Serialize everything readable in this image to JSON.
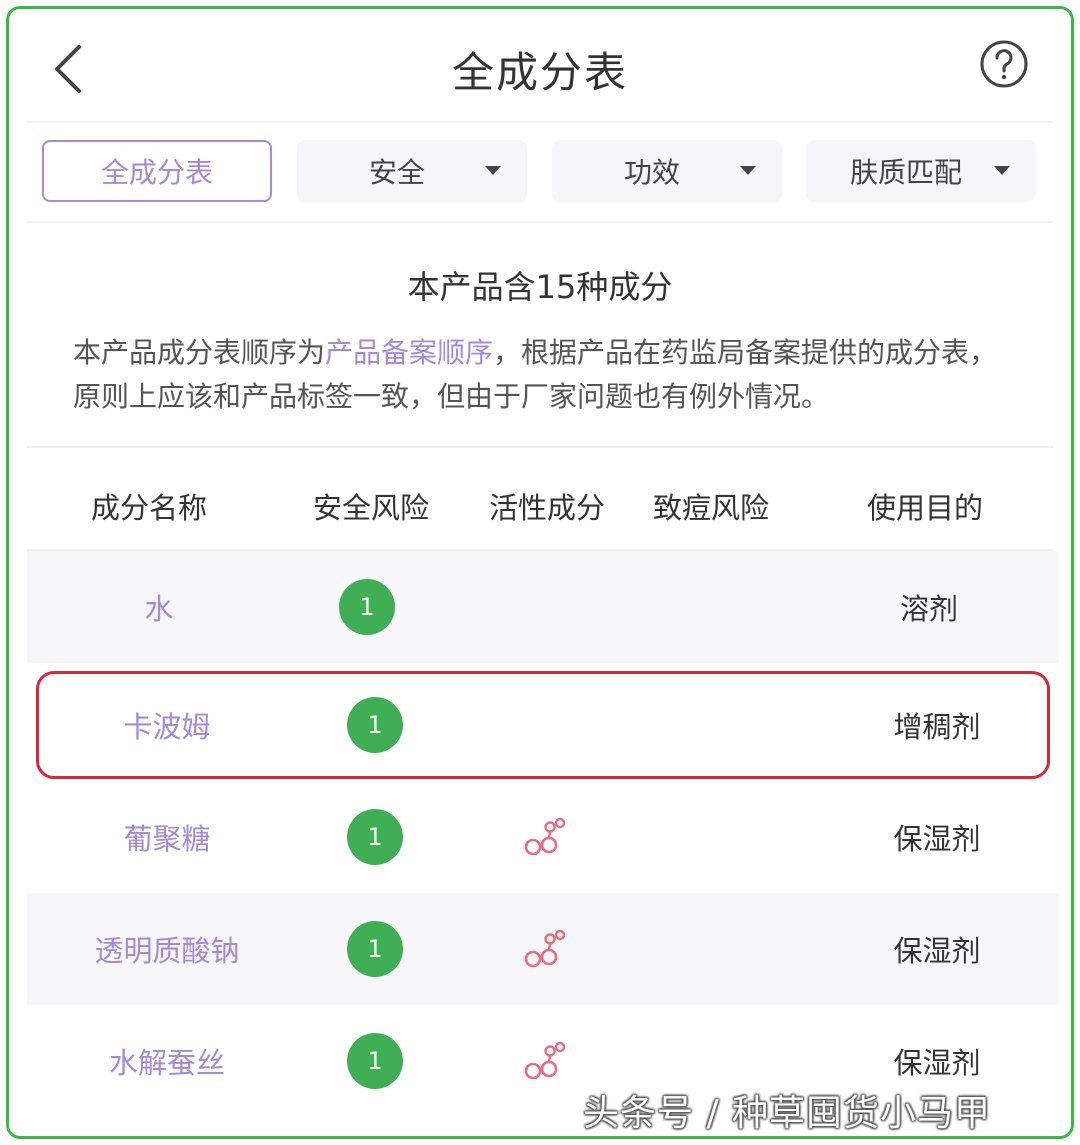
{
  "header": {
    "title": "全成分表",
    "back_icon": "chevron-left-icon",
    "help_icon": "question-circle-icon"
  },
  "tabs": [
    {
      "label": "全成分表",
      "active": true
    },
    {
      "label": "安全",
      "active": false
    },
    {
      "label": "功效",
      "active": false
    },
    {
      "label": "肤质匹配",
      "active": false
    }
  ],
  "summary": {
    "title": "本产品含15种成分",
    "text_before": "本产品成分表顺序为",
    "text_highlight": "产品备案顺序",
    "text_after": "，根据产品在药监局备案提供的成分表，原则上应该和产品标签一致，但由于厂家问题也有例外情况。"
  },
  "table": {
    "columns": [
      "成分名称",
      "安全风险",
      "活性成分",
      "致痘风险",
      "使用目的"
    ],
    "rows": [
      {
        "name": "水",
        "safety": "1",
        "active": false,
        "purpose": "溶剂"
      },
      {
        "name": "卡波姆",
        "safety": "1",
        "active": false,
        "purpose": "增稠剂"
      },
      {
        "name": "葡聚糖",
        "safety": "1",
        "active": true,
        "purpose": "保湿剂"
      },
      {
        "name": "透明质酸钠",
        "safety": "1",
        "active": true,
        "purpose": "保湿剂"
      },
      {
        "name": "水解蚕丝",
        "safety": "1",
        "active": true,
        "purpose": "保湿剂"
      }
    ]
  },
  "colors": {
    "accent": "#a48ad8",
    "safety_green": "#3fae55",
    "active_icon": "#e86c7f",
    "highlight_border": "#d8293a",
    "frame_border": "#3cb84a"
  },
  "watermark": "头条号 / 种草囤货小马甲"
}
